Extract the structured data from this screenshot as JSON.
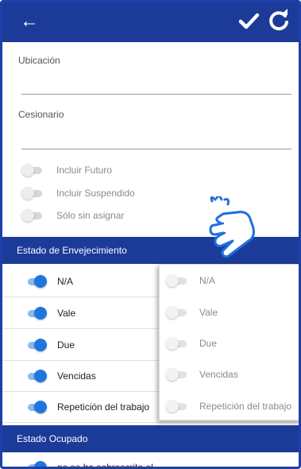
{
  "appbar": {
    "back_icon": "arrow-left-icon",
    "save_icon": "check-icon",
    "refresh_icon": "refresh-icon",
    "color": "#1c3b99"
  },
  "fields": {
    "ubicacion_label": "Ubicación",
    "cesionario_label": "Cesionario"
  },
  "options": [
    {
      "label": "Incluir Futuro",
      "on": false
    },
    {
      "label": "Incluir Suspendido",
      "on": false
    },
    {
      "label": "Sólo sin asignar",
      "on": false
    }
  ],
  "aging_section": {
    "title": "Estado de Envejecimiento",
    "items": [
      {
        "label": "N/A",
        "on": true
      },
      {
        "label": "Vale",
        "on": true
      },
      {
        "label": "Due",
        "on": true
      },
      {
        "label": "Vencidas",
        "on": true
      },
      {
        "label": "Repetición del trabajo",
        "on": true
      }
    ]
  },
  "popup": {
    "items": [
      {
        "label": "N/A",
        "on": false
      },
      {
        "label": "Vale",
        "on": false
      },
      {
        "label": "Due",
        "on": false
      },
      {
        "label": "Vencidas",
        "on": false
      },
      {
        "label": "Repetición del trabajo",
        "on": false
      }
    ]
  },
  "occupied_section": {
    "title": "Estado Ocupado",
    "first_item": "no se ha sobrescrito el"
  },
  "colors": {
    "accent": "#1e76e0",
    "header": "#1c3b99"
  }
}
